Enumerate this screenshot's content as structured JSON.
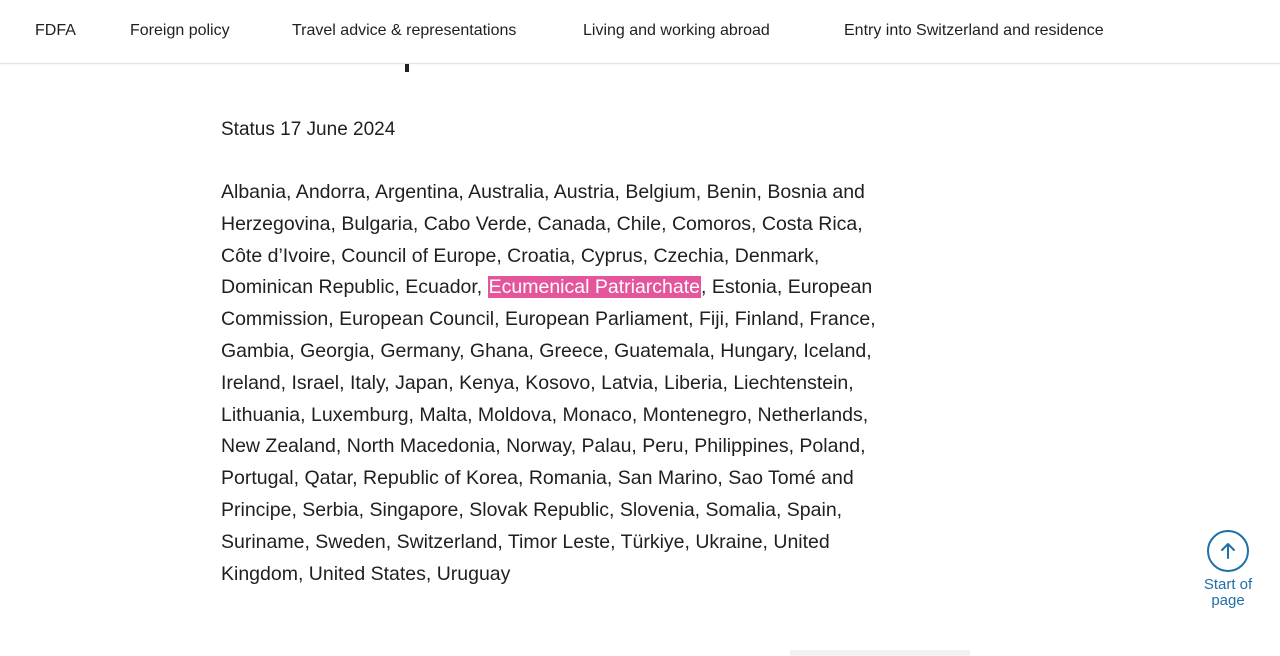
{
  "nav": {
    "items": [
      {
        "label": "FDFA"
      },
      {
        "label": "Foreign policy"
      },
      {
        "label": "Travel advice & representations"
      },
      {
        "label": "Living and working abroad"
      },
      {
        "label": "Entry into Switzerland and residence"
      }
    ]
  },
  "main": {
    "status": "Status 17 June 2024",
    "countries_lines": [
      "Albania, Andorra, Argentina, Australia, Austria, Belgium, Benin, Bosnia and",
      "Herzegovina, Bulgaria, Cabo Verde, Canada, Chile, Comoros, Costa Rica,",
      "Côte d’Ivoire, Council of Europe, Croatia, Cyprus, Czechia, Denmark,",
      {
        "before": "Dominican Republic, Ecuador, ",
        "highlight": "Ecumenical Patriarchate",
        "after": ", Estonia, European"
      },
      "Commission, European Council, European Parliament, Fiji, Finland, France,",
      "Gambia, Georgia, Germany, Ghana, Greece, Guatemala, Hungary, Iceland,",
      "Ireland, Israel, Italy, Japan, Kenya, Kosovo, Latvia, Liberia, Liechtenstein,",
      "Lithuania, Luxemburg, Malta, Moldova, Monaco, Montenegro, Netherlands,",
      "New Zealand, North Macedonia, Norway, Palau, Peru, Philippines, Poland,",
      "Portugal, Qatar, Republic of Korea, Romania, San Marino, Sao Tomé and",
      "Principe, Serbia, Singapore, Slovak Republic, Slovenia, Somalia, Spain,",
      "Suriname, Sweden, Switzerland, Timor Leste, Türkiye, Ukraine, United",
      "Kingdom, United States, Uruguay"
    ],
    "highlight_color": "#e4559b"
  },
  "back_to_top": {
    "label_line1": "Start of",
    "label_line2": "page",
    "icon": "arrow-up-circle-icon",
    "color": "#1f6fa8"
  }
}
